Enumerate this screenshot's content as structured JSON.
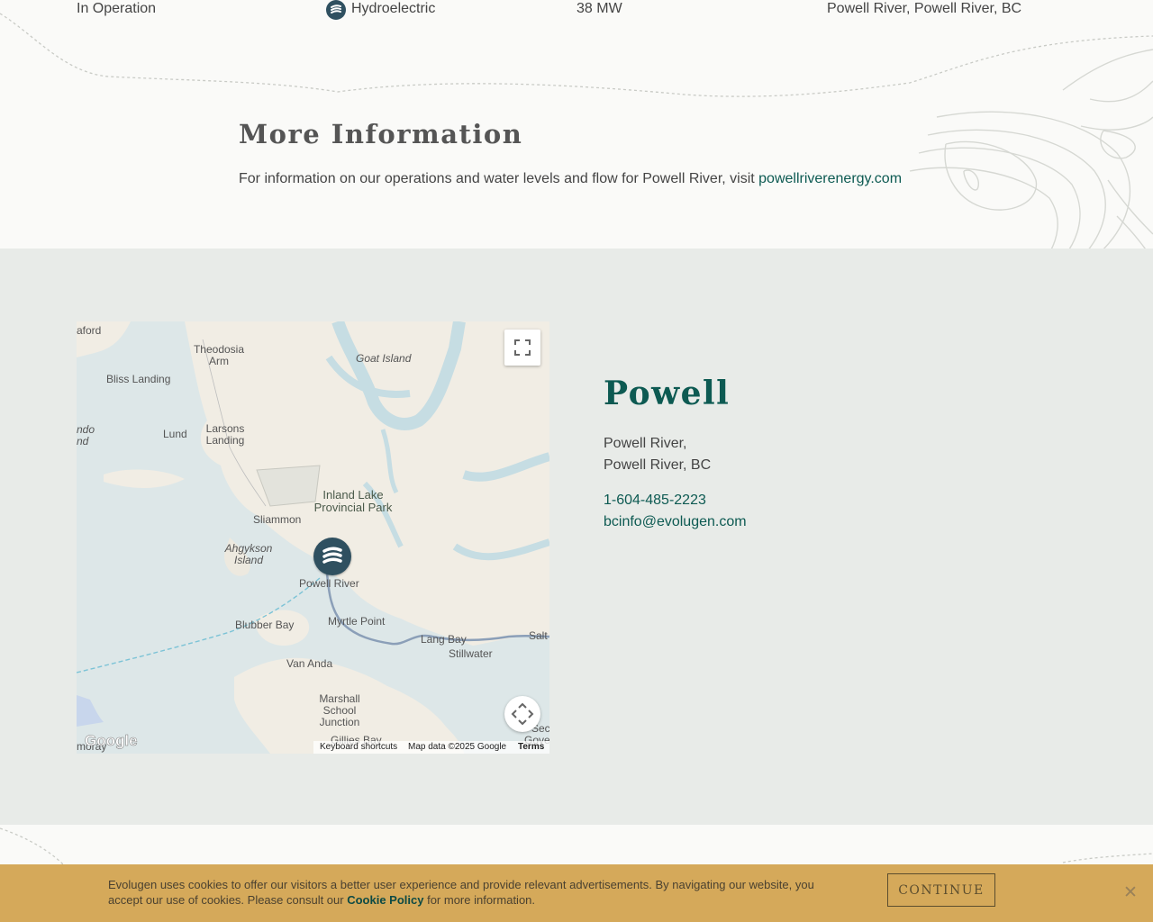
{
  "project_row": {
    "status": "In Operation",
    "type": "Hydroelectric",
    "type_icon": "hydro-icon",
    "capacity": "38 MW",
    "location": "Powell River, Powell River, BC"
  },
  "more_info": {
    "heading": "More Information",
    "text": "For information on our operations and water levels and flow for Powell River, visit ",
    "link": "powellriverenergy.com"
  },
  "map": {
    "labels": {
      "saford": "aford",
      "theodosia": "Theodosia Arm",
      "goat": "Goat Island",
      "bliss": "Bliss Landing",
      "lund": "Lund",
      "larsons": "Larsons Landing",
      "ndo": "ndo nd",
      "inland": "Inland Lake Provincial Park",
      "sliammon": "Sliammon",
      "ahgykson": "Ahgykson Island",
      "powell_river": "Powell River",
      "myrtle": "Myrtle Point",
      "blubber": "Blubber Bay",
      "lang_bay": "Lang Bay",
      "stillwater": "Stillwater",
      "saltery": "Salt",
      "van_anda": "Van Anda",
      "marshall": "Marshall School Junction",
      "gillies": "Gillies Bay",
      "secheldt": "Seche",
      "gove": "Gove",
      "moray": "moray"
    },
    "google_logo": "Google",
    "keyboard_shortcuts": "Keyboard shortcuts",
    "map_data": "Map data ©2025 Google",
    "terms": "Terms",
    "marker_icon": "hydro-icon"
  },
  "location": {
    "name": "Powell",
    "address_line1": "Powell River,",
    "address_line2": "Powell River, BC",
    "phone": "1-604-485-2223",
    "email": "bcinfo@evolugen.com"
  },
  "cookie": {
    "message_before": "Evolugen uses cookies to offer our visitors a better user experience and provide relevant advertisements. By navigating our website, you accept our use of cookies. Please consult our ",
    "policy_link": "Cookie Policy",
    "message_after": " for more information.",
    "continue_label": "CONTINUE",
    "close_glyph": "✕"
  },
  "colors": {
    "brand_green": "#0d5a52",
    "marker_blue": "#2f5060",
    "cookie_bar": "#d5a95a",
    "section_gray": "#e8ebe8"
  }
}
